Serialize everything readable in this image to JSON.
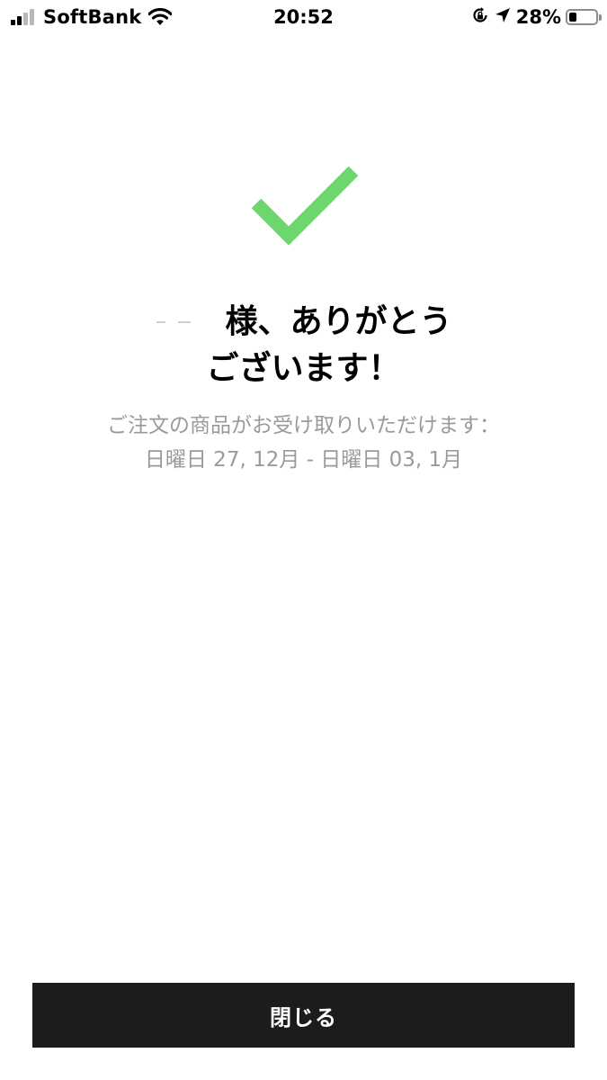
{
  "status_bar": {
    "carrier": "SoftBank",
    "time": "20:52",
    "battery_percent": "28%",
    "battery_level": 0.28,
    "signal_bars_active": 2,
    "signal_bars_total": 4,
    "icons": [
      "signal-icon",
      "wifi-icon",
      "orientation-lock-icon",
      "location-arrow-icon",
      "battery-icon"
    ]
  },
  "confirmation": {
    "icon": "checkmark-icon",
    "icon_color": "#6dd66d",
    "thanks_line1": "様、ありがとう",
    "thanks_line2": "ございます！",
    "delivery_label": "ご注文の商品がお受け取りいただけます：",
    "delivery_range": "日曜日 27, 12月 - 日曜日 03, 1月"
  },
  "actions": {
    "close_label": "閉じる",
    "button_color": "#1c1c1c"
  }
}
